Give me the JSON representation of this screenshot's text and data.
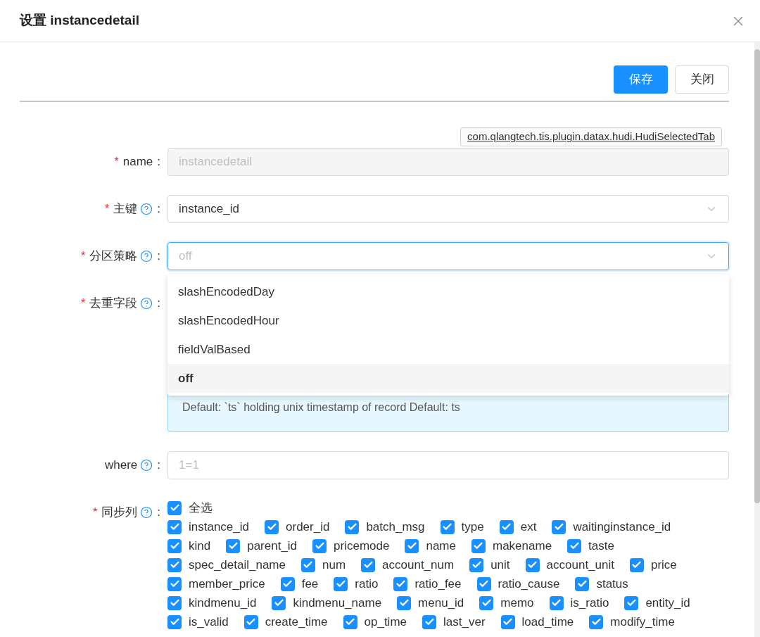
{
  "dialog": {
    "title": "设置 instancedetail"
  },
  "buttons": [
    {
      "label": "保存",
      "kind": "primary"
    },
    {
      "label": "关闭",
      "kind": "default"
    }
  ],
  "plugin_tag": "com.qlangtech.tis.plugin.datax.hudi.HudiSelectedTab",
  "fields": [
    {
      "label": "name",
      "required": "*",
      "colon": ":",
      "kind": "input",
      "value": "instancedetail",
      "disabled": true
    },
    {
      "label": "主键",
      "required": "*",
      "colon": ":",
      "help": true,
      "kind": "select",
      "value": "instance_id",
      "focused": false
    },
    {
      "label": "分区策略",
      "required": "*",
      "colon": ":",
      "help": true,
      "kind": "select",
      "placeholder": "off",
      "focused": true,
      "options": [
        {
          "label": "slashEncodedDay",
          "selected": false
        },
        {
          "label": "slashEncodedHour",
          "selected": false
        },
        {
          "label": "fieldValBased",
          "selected": false
        },
        {
          "label": "off",
          "selected": true
        }
      ]
    },
    {
      "label": "去重字段",
      "required": "*",
      "colon": ":",
      "help": true,
      "kind": "covered",
      "description": "Default: `ts` holding unix timestamp of record Default: ts"
    },
    {
      "label": "where",
      "colon": ":",
      "help": true,
      "kind": "input",
      "placeholder": "1=1",
      "disabled": false
    },
    {
      "label": "同步列",
      "required": "*",
      "colon": ":",
      "help": true,
      "kind": "checkboxes",
      "rows": [
        [
          {
            "label": "全选",
            "checked": true
          }
        ],
        [
          {
            "label": "instance_id",
            "checked": true
          },
          {
            "label": "order_id",
            "checked": true
          },
          {
            "label": "batch_msg",
            "checked": true
          },
          {
            "label": "type",
            "checked": true
          },
          {
            "label": "ext",
            "checked": true
          },
          {
            "label": "waitinginstance_id",
            "checked": true
          }
        ],
        [
          {
            "label": "kind",
            "checked": true
          },
          {
            "label": "parent_id",
            "checked": true
          },
          {
            "label": "pricemode",
            "checked": true
          },
          {
            "label": "name",
            "checked": true
          },
          {
            "label": "makename",
            "checked": true
          },
          {
            "label": "taste",
            "checked": true
          }
        ],
        [
          {
            "label": "spec_detail_name",
            "checked": true
          },
          {
            "label": "num",
            "checked": true
          },
          {
            "label": "account_num",
            "checked": true
          },
          {
            "label": "unit",
            "checked": true
          },
          {
            "label": "account_unit",
            "checked": true
          },
          {
            "label": "price",
            "checked": true
          }
        ],
        [
          {
            "label": "member_price",
            "checked": true
          },
          {
            "label": "fee",
            "checked": true
          },
          {
            "label": "ratio",
            "checked": true
          },
          {
            "label": "ratio_fee",
            "checked": true
          },
          {
            "label": "ratio_cause",
            "checked": true
          },
          {
            "label": "status",
            "checked": true
          }
        ],
        [
          {
            "label": "kindmenu_id",
            "checked": true
          },
          {
            "label": "kindmenu_name",
            "checked": true
          },
          {
            "label": "menu_id",
            "checked": true
          },
          {
            "label": "memo",
            "checked": true
          },
          {
            "label": "is_ratio",
            "checked": true
          },
          {
            "label": "entity_id",
            "checked": true
          }
        ],
        [
          {
            "label": "is_valid",
            "checked": true
          },
          {
            "label": "create_time",
            "checked": true
          },
          {
            "label": "op_time",
            "checked": true
          },
          {
            "label": "last_ver",
            "checked": true
          },
          {
            "label": "load_time",
            "checked": true
          },
          {
            "label": "modify_time",
            "checked": true
          }
        ]
      ]
    }
  ]
}
